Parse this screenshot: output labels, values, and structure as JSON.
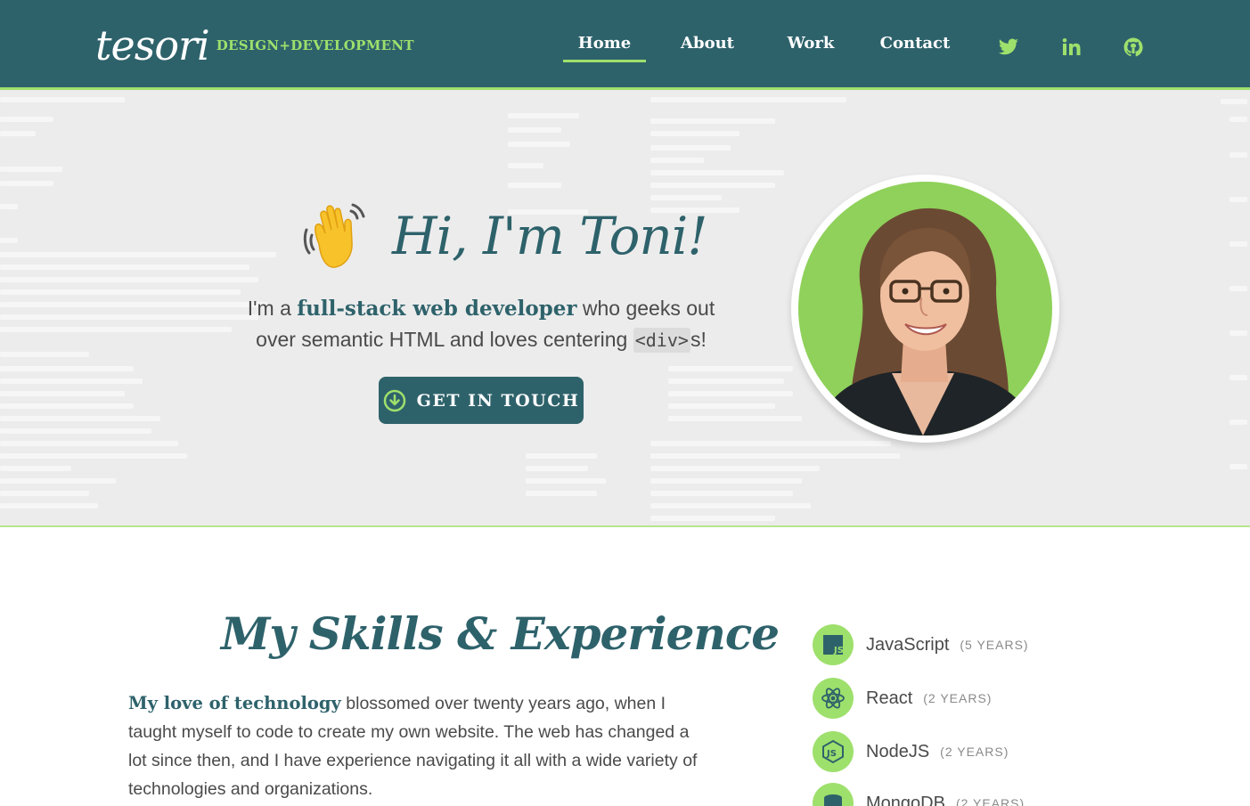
{
  "brand": {
    "logo_script": "tesori",
    "tagline": "DESIGN+DEVELOPMENT",
    "accent_color": "#9ee06c",
    "primary_color": "#2e626b"
  },
  "nav": {
    "items": [
      {
        "label": "Home",
        "active": true
      },
      {
        "label": "About",
        "active": false
      },
      {
        "label": "Work",
        "active": false
      },
      {
        "label": "Contact",
        "active": false
      }
    ],
    "social": [
      "twitter-icon",
      "linkedin-icon",
      "github-icon"
    ]
  },
  "hero": {
    "heading": "Hi, I'm Toni!",
    "text_before": "I'm a ",
    "highlight": "full-stack web developer",
    "text_middle": " who geeks out over semantic HTML and loves centering ",
    "code": "<div>",
    "text_after": "s!",
    "cta_label": "GET IN TOUCH"
  },
  "skills": {
    "title": "My Skills & Experience",
    "intro_highlight": "My love of technology",
    "intro_text": " blossomed over twenty years ago, when I taught myself to code to create my own website. The web has changed a lot since then, and I have experience navigating it all with a wide variety of technologies and organizations.",
    "items": [
      {
        "name": "JavaScript",
        "years": "(5 YEARS)",
        "icon": "javascript-icon"
      },
      {
        "name": "React",
        "years": "(2 YEARS)",
        "icon": "react-icon"
      },
      {
        "name": "NodeJS",
        "years": "(2 YEARS)",
        "icon": "nodejs-icon"
      },
      {
        "name": "MongoDB",
        "years": "(2 YEARS)",
        "icon": "mongodb-icon"
      }
    ]
  }
}
